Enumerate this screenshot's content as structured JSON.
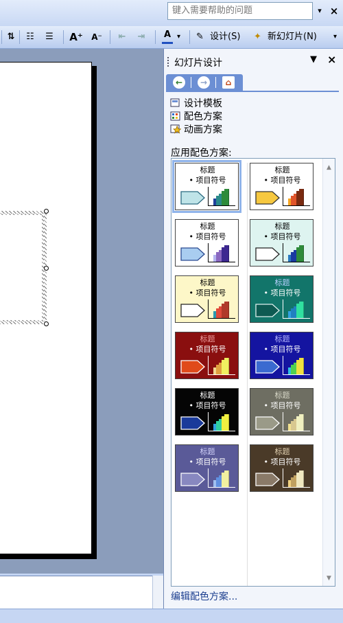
{
  "help": {
    "placeholder": "键入需要帮助的问题",
    "dropdown_glyph": "▾",
    "close_glyph": "×"
  },
  "toolbar": {
    "design_label": "设计(S)",
    "new_slide_label": "新幻灯片(N)",
    "font_color_glyph": "A",
    "increase_font_glyph": "A⁺",
    "decrease_font_glyph": "A⁻",
    "bullets_glyph": "☰",
    "numbering_glyph": "☷"
  },
  "pane": {
    "title": "幻灯片设计",
    "menu_glyph": "▼",
    "close_glyph": "×",
    "links": [
      {
        "label": "设计模板",
        "icon": "design-template-icon"
      },
      {
        "label": "配色方案",
        "icon": "color-scheme-icon"
      },
      {
        "label": "动画方案",
        "icon": "animation-scheme-icon"
      }
    ],
    "apply_label": "应用配色方案:",
    "edit_label": "编辑配色方案...",
    "schemes": [
      {
        "title": "标题",
        "bullet": "• 项目符号",
        "bg": "#ffffff",
        "text": "#000000",
        "title_color": "#000000",
        "arrow_fill": "#bfe4e8",
        "arrow_stroke": "#2a6a80",
        "axis": "#000000",
        "bars": [
          "#1f3f9a",
          "#2a8a8a",
          "#2e8b3a"
        ],
        "selected": true
      },
      {
        "title": "标题",
        "bullet": "• 项目符号",
        "bg": "#ffffff",
        "text": "#000000",
        "title_color": "#000000",
        "arrow_fill": "#f6c840",
        "arrow_stroke": "#333333",
        "axis": "#000000",
        "bars": [
          "#f6a623",
          "#e0542a",
          "#7a2a10"
        ],
        "selected": false
      },
      {
        "title": "标题",
        "bullet": "• 项目符号",
        "bg": "#ffffff",
        "text": "#000000",
        "title_color": "#000000",
        "arrow_fill": "#a9cdf0",
        "arrow_stroke": "#2a4a90",
        "axis": "#000000",
        "bars": [
          "#b5b5f0",
          "#8a68c0",
          "#3d2890"
        ],
        "selected": false
      },
      {
        "title": "标题",
        "bullet": "• 项目符号",
        "bg": "#def4f0",
        "text": "#000000",
        "title_color": "#000000",
        "arrow_fill": "#ffffff",
        "arrow_stroke": "#222222",
        "axis": "#000000",
        "bars": [
          "#2a7ac0",
          "#1a3aa0",
          "#2e8b3a"
        ],
        "selected": false
      },
      {
        "title": "标题",
        "bullet": "• 项目符号",
        "bg": "#fdf7c8",
        "text": "#000000",
        "title_color": "#000000",
        "arrow_fill": "#ffffff",
        "arrow_stroke": "#222222",
        "axis": "#000000",
        "bars": [
          "#2a9ab0",
          "#e04a3a",
          "#b03a2a"
        ],
        "selected": false
      },
      {
        "title": "标题",
        "bullet": "• 项目符号",
        "bg": "#12756a",
        "text": "#ffffff",
        "title_color": "#b8d0ff",
        "arrow_fill": "#0e5a52",
        "arrow_stroke": "#e0f0ee",
        "axis": "#ffffff",
        "bars": [
          "#30a0e0",
          "#2080c0",
          "#30e0a0"
        ],
        "selected": false
      },
      {
        "title": "标题",
        "bullet": "• 项目符号",
        "bg": "#8a0f0f",
        "text": "#ffffff",
        "title_color": "#f0a0a0",
        "arrow_fill": "#e04a1a",
        "arrow_stroke": "#ffffff",
        "axis": "#ffffff",
        "bars": [
          "#f0d890",
          "#e0a040",
          "#f0f060"
        ],
        "selected": false
      },
      {
        "title": "标题",
        "bullet": "• 项目符号",
        "bg": "#1414a0",
        "text": "#ffffff",
        "title_color": "#b8b8ff",
        "arrow_fill": "#3a6ad0",
        "arrow_stroke": "#ffffff",
        "axis": "#ffffff",
        "bars": [
          "#30c0e0",
          "#50d050",
          "#f0e040"
        ],
        "selected": false
      },
      {
        "title": "标题",
        "bullet": "• 项目符号",
        "bg": "#050505",
        "text": "#ffffff",
        "title_color": "#ffffff",
        "arrow_fill": "#1a3a9a",
        "arrow_stroke": "#ffffff",
        "axis": "#ffffff",
        "bars": [
          "#30a0e0",
          "#30d0a0",
          "#f0f040"
        ],
        "selected": false
      },
      {
        "title": "标题",
        "bullet": "• 项目符号",
        "bg": "#6e6e62",
        "text": "#ffffff",
        "title_color": "#d8d8c8",
        "arrow_fill": "#9a9a88",
        "arrow_stroke": "#ffffff",
        "axis": "#ffffff",
        "bars": [
          "#f0e090",
          "#d8c890",
          "#f0f0c0"
        ],
        "selected": false
      },
      {
        "title": "标题",
        "bullet": "• 项目符号",
        "bg": "#5a5a98",
        "text": "#ffffff",
        "title_color": "#d0d0f8",
        "arrow_fill": "#8888c0",
        "arrow_stroke": "#ffffff",
        "axis": "#ffffff",
        "bars": [
          "#a0c0f0",
          "#6090e0",
          "#f0f0a0"
        ],
        "selected": false
      },
      {
        "title": "标题",
        "bullet": "• 项目符号",
        "bg": "#4a3a28",
        "text": "#ffffff",
        "title_color": "#e0d0b0",
        "arrow_fill": "#8a7a68",
        "arrow_stroke": "#ffffff",
        "axis": "#ffffff",
        "bars": [
          "#f0d080",
          "#c0a060",
          "#f0e8c0"
        ],
        "selected": false
      }
    ]
  }
}
